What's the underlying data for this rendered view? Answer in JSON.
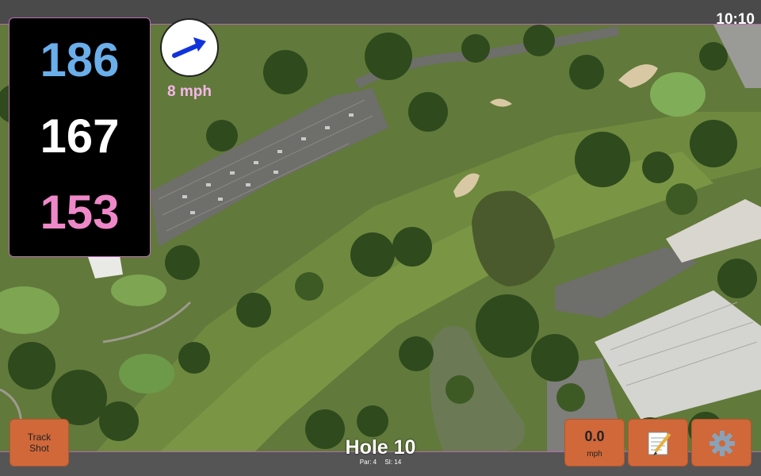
{
  "clock": "10:10",
  "distances": {
    "back": "186",
    "middle": "167",
    "front": "153"
  },
  "wind": {
    "speed": "8 mph",
    "icon": "wind-arrow-icon"
  },
  "buttons": {
    "track_shot": "Track\nShot",
    "speed_value": "0.0",
    "speed_unit": "mph",
    "notes_icon": "notepad-icon",
    "settings_icon": "gear-icon"
  },
  "hole": {
    "title": "Hole 10",
    "par": "Par: 4",
    "si": "SI: 14"
  },
  "colors": {
    "back_distance": "#6aaeea",
    "middle_distance": "#ffffff",
    "front_distance": "#ee88c8",
    "button": "#d0683a",
    "panel_border": "#c06fbd"
  }
}
